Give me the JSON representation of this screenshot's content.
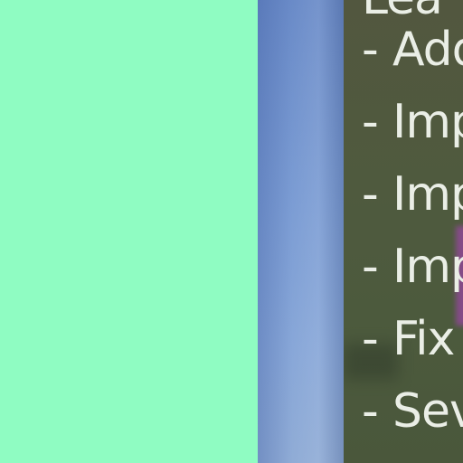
{
  "panels": {
    "left_color": "#8ffcc2",
    "strip_color": "#7c9dd4",
    "notes_color": "#4f5a3e"
  },
  "notes": {
    "heading": "Lea",
    "items": [
      {
        "bullet": "-",
        "text": "Add"
      },
      {
        "bullet": "-",
        "text": "Imp"
      },
      {
        "bullet": "-",
        "text": "Imp"
      },
      {
        "bullet": "-",
        "text": "Imp"
      },
      {
        "bullet": "-",
        "text": "Fix"
      },
      {
        "bullet": "-",
        "text": "Sev"
      }
    ]
  }
}
